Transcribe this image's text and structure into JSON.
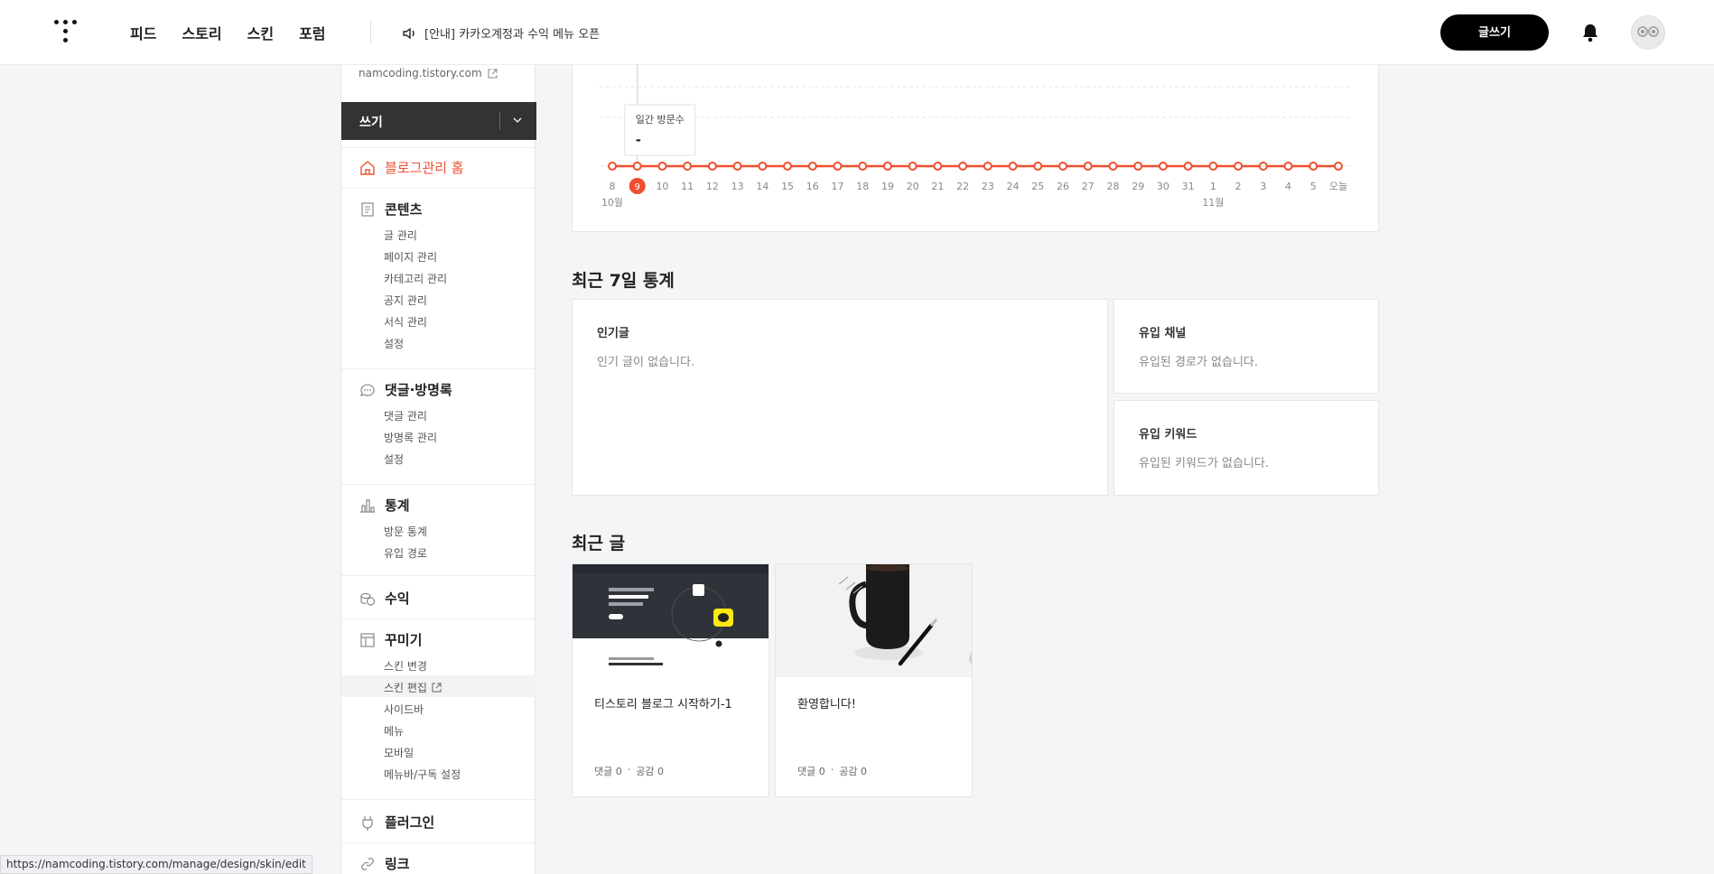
{
  "nav": {
    "items": [
      "피드",
      "스토리",
      "스킨",
      "포럼"
    ]
  },
  "notice": "[안내] 카카오계정과 수익 메뉴 오픈",
  "header": {
    "write_label": "글쓰기"
  },
  "sidebar": {
    "blog_url": "namcoding.tistory.com",
    "write_label": "쓰기",
    "home_label": "블로그관리 홈",
    "sections": [
      {
        "title": "콘텐츠",
        "items": [
          "글 관리",
          "페이지 관리",
          "카테고리 관리",
          "공지 관리",
          "서식 관리",
          "설정"
        ]
      },
      {
        "title": "댓글·방명록",
        "items": [
          "댓글 관리",
          "방명록 관리",
          "설정"
        ]
      },
      {
        "title": "통계",
        "items": [
          "방문 통계",
          "유입 경로"
        ]
      },
      {
        "title": "수익",
        "items": []
      },
      {
        "title": "꾸미기",
        "items": [
          "스킨 변경",
          "스킨 편집",
          "사이드바",
          "메뉴",
          "모바일",
          "메뉴바/구독 설정"
        ]
      },
      {
        "title": "플러그인",
        "items": []
      },
      {
        "title": "링크",
        "items": []
      }
    ]
  },
  "chart_data": {
    "type": "line",
    "x": [
      "8",
      "9",
      "10",
      "11",
      "12",
      "13",
      "14",
      "15",
      "16",
      "17",
      "18",
      "19",
      "20",
      "21",
      "22",
      "23",
      "24",
      "25",
      "26",
      "27",
      "28",
      "29",
      "30",
      "31",
      "1",
      "2",
      "3",
      "4",
      "5",
      "오늘"
    ],
    "month_labels": [
      {
        "label": "10월",
        "at": "8"
      },
      {
        "label": "11월",
        "at": "1"
      }
    ],
    "series": [
      {
        "values": [
          0,
          0,
          0,
          0,
          0,
          0,
          0,
          0,
          0,
          0,
          0,
          0,
          0,
          0,
          0,
          0,
          0,
          0,
          0,
          0,
          0,
          0,
          0,
          0,
          0,
          0,
          0,
          0,
          0,
          0
        ],
        "color": "#f04e30"
      }
    ],
    "highlight": "9",
    "tooltip": {
      "label": "일간 방문수",
      "value": "-"
    },
    "grid": true
  },
  "stats": {
    "title": "최근 7일 통계",
    "popular": {
      "title": "인기글",
      "empty": "인기 글이 없습니다."
    },
    "channel": {
      "title": "유입 채널",
      "empty": "유입된 경로가 없습니다."
    },
    "keyword": {
      "title": "유입 키워드",
      "empty": "유입된 키워드가 없습니다."
    }
  },
  "recent": {
    "title": "최근 글",
    "posts": [
      {
        "title": "티스토리 블로그 시작하기-1",
        "comments": "댓글 0",
        "likes": "공감 0"
      },
      {
        "title": "환영합니다!",
        "comments": "댓글 0",
        "likes": "공감 0"
      }
    ]
  },
  "status_url": "https://namcoding.tistory.com/manage/design/skin/edit"
}
